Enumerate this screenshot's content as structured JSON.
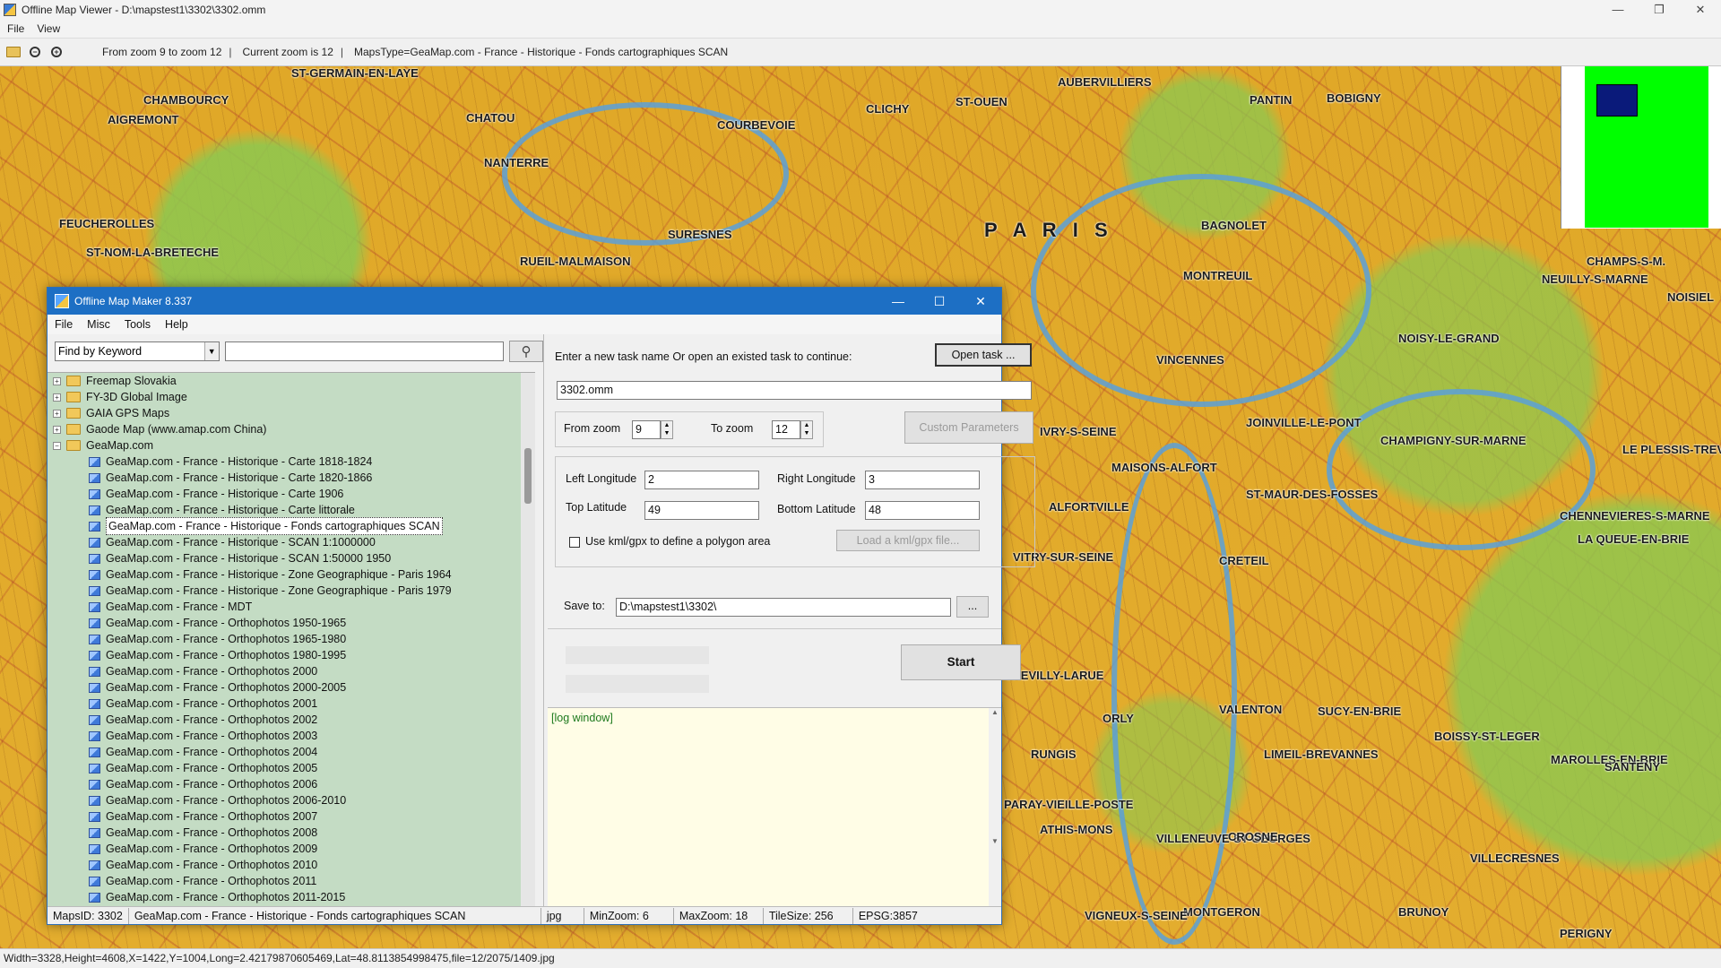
{
  "outer_window": {
    "title": "Offline Map Viewer - D:\\mapstest1\\3302\\3302.omm",
    "menu": [
      "File",
      "View"
    ],
    "toolbar": {
      "zoom_range": "From zoom 9 to zoom 12",
      "current_zoom": "Current zoom is 12",
      "maps_type": "MapsType=GeaMap.com - France - Historique - Fonds cartographiques SCAN"
    },
    "status": "Width=3328,Height=4608,X=1422,Y=1004,Long=2.42179870605469,Lat=48.8113854998475,file=12/2075/1409.jpg"
  },
  "map": {
    "places": [
      "ST-GERMAIN-EN-LAYE",
      "CHATOU",
      "NANTERRE",
      "COURBEVOIE",
      "CLICHY",
      "ST-OUEN",
      "AUBERVILLIERS",
      "PANTIN",
      "BOBIGNY",
      "P A R I S",
      "MONTREUIL",
      "VINCENNES",
      "RUEIL-MALMAISON",
      "SURESNES",
      "BAGNOLET",
      "NEUILLY-S-MARNE",
      "CHAMPS-S-M.",
      "NOISY-LE-GRAND",
      "ALFORTVILLE",
      "CRETEIL",
      "VITRY-SUR-SEINE",
      "MAISONS-ALFORT",
      "CHEVILLY-LARUE",
      "VILLENEUVE-ST-GEORGES",
      "SUCY-EN-BRIE",
      "BOISSY-ST-LEGER",
      "VALENTON",
      "LIMEIL-BREVANNES",
      "MAROLLES-EN-BRIE",
      "ATHIS-MONS",
      "MONTGERON",
      "CROSNE",
      "BRUNOY",
      "VIGNEUX-S-SEINE",
      "FEUCHEROLLES",
      "ST-NOM-LA-BRETECHE",
      "CHAMBOURCY",
      "AIGREMONT",
      "NOISIEL",
      "CHENNEVIERES-S-MARNE",
      "LE PLESSIS-TREVISE",
      "CHAMPIGNY-SUR-MARNE",
      "ST-MAUR-DES-FOSSES",
      "JOINVILLE-LE-PONT",
      "IVRY-S-SEINE",
      "ORLY",
      "RUNGIS",
      "PARAY-VIEILLE-POSTE",
      "VILLECRESNES",
      "LA QUEUE-EN-BRIE",
      "SANTENY",
      "PERIGNY"
    ]
  },
  "dialog": {
    "title": "Offline Map Maker 8.337",
    "menu": [
      "File",
      "Misc",
      "Tools",
      "Help"
    ],
    "search": {
      "mode": "Find by Keyword",
      "value": ""
    },
    "tree": {
      "folders": [
        {
          "label": "Freemap Slovakia",
          "expanded": false
        },
        {
          "label": "FY-3D Global Image",
          "expanded": false
        },
        {
          "label": "GAIA GPS Maps",
          "expanded": false
        },
        {
          "label": "Gaode Map (www.amap.com China)",
          "expanded": false
        },
        {
          "label": "GeaMap.com",
          "expanded": true
        }
      ],
      "children": [
        "GeaMap.com - France - Historique - Carte 1818-1824",
        "GeaMap.com - France - Historique - Carte 1820-1866",
        "GeaMap.com - France - Historique - Carte 1906",
        "GeaMap.com - France - Historique - Carte littorale",
        "GeaMap.com - France - Historique - Fonds cartographiques SCAN",
        "GeaMap.com - France - Historique - SCAN 1:1000000",
        "GeaMap.com - France - Historique - SCAN 1:50000 1950",
        "GeaMap.com - France - Historique - Zone Geographique - Paris 1964",
        "GeaMap.com - France - Historique - Zone Geographique - Paris 1979",
        "GeaMap.com - France - MDT",
        "GeaMap.com - France - Orthophotos 1950-1965",
        "GeaMap.com - France - Orthophotos 1965-1980",
        "GeaMap.com - France - Orthophotos 1980-1995",
        "GeaMap.com - France - Orthophotos 2000",
        "GeaMap.com - France - Orthophotos 2000-2005",
        "GeaMap.com - France - Orthophotos 2001",
        "GeaMap.com - France - Orthophotos 2002",
        "GeaMap.com - France - Orthophotos 2003",
        "GeaMap.com - France - Orthophotos 2004",
        "GeaMap.com - France - Orthophotos 2005",
        "GeaMap.com - France - Orthophotos 2006",
        "GeaMap.com - France - Orthophotos 2006-2010",
        "GeaMap.com - France - Orthophotos 2007",
        "GeaMap.com - France - Orthophotos 2008",
        "GeaMap.com - France - Orthophotos 2009",
        "GeaMap.com - France - Orthophotos 2010",
        "GeaMap.com - France - Orthophotos 2011",
        "GeaMap.com - France - Orthophotos 2011-2015"
      ],
      "selected": "GeaMap.com - France - Historique - Fonds cartographiques SCAN"
    },
    "task": {
      "prompt": "Enter a new task name Or open an existed task to continue:",
      "open_button": "Open task ...",
      "name": "3302.omm"
    },
    "zoom": {
      "from_label": "From zoom",
      "from_value": "9",
      "to_label": "To zoom",
      "to_value": "12",
      "custom_button": "Custom Parameters"
    },
    "area": {
      "left_lon_label": "Left Longitude",
      "left_lon": "2",
      "right_lon_label": "Right Longitude",
      "right_lon": "3",
      "top_lat_label": "Top Latitude",
      "top_lat": "49",
      "bottom_lat_label": "Bottom Latitude",
      "bottom_lat": "48",
      "kml_checkbox_label": "Use kml/gpx to define a polygon area",
      "kml_checked": false,
      "kml_button": "Load a kml/gpx file..."
    },
    "save": {
      "label": "Save to:",
      "path": "D:\\mapstest1\\3302\\",
      "browse": "..."
    },
    "start_button": "Start",
    "log": "[log window]",
    "status": {
      "maps_id": "MapsID: 3302",
      "map_name": "GeaMap.com - France - Historique - Fonds cartographiques SCAN",
      "format": "jpg",
      "min_zoom": "MinZoom: 6",
      "max_zoom": "MaxZoom: 18",
      "tile_size": "TileSize: 256",
      "epsg": "EPSG:3857"
    }
  },
  "colors": {
    "dialog_title": "#1d6fc4",
    "tree_bg": "#c4dcc4",
    "log_bg": "#fffde6",
    "map_base": "#e0a828",
    "overview_green": "#00ff00",
    "overview_rect": "#0a1a7a"
  }
}
